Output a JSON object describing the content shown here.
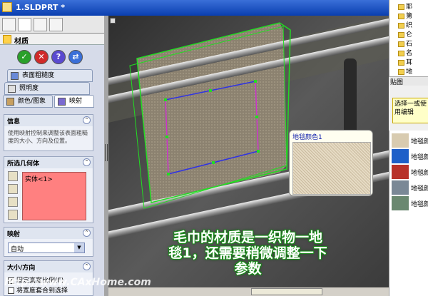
{
  "window": {
    "title": "1.SLDPRT *"
  },
  "panel": {
    "header": "材质",
    "tabs": [
      {
        "label": "表面粗糙度"
      },
      {
        "label": "照明度"
      },
      {
        "label": "颜色/图象"
      },
      {
        "label": "映射"
      }
    ],
    "info": {
      "title": "信息",
      "text": "使用映射控制来调整该表面粗糙度的大小、方向及位置。"
    },
    "selected_geometry": {
      "title": "所选几何体",
      "item": "实体<1>"
    },
    "mapping": {
      "title": "映射",
      "value": "自动"
    },
    "size_direction": {
      "title": "大小/方向",
      "fixed_ratio_label": "固定高宽比例(F)",
      "fixed_ratio_checked": true,
      "second_label": "将宽度套合到选择"
    }
  },
  "viewport": {
    "callout_title": "地毯颜色1",
    "caption_line1": "毛巾的材质是一织物一地",
    "caption_line2": "毯1，还需要稍微调整一下",
    "caption_line3": "参数"
  },
  "watermark": "http://www.CAxHome.com",
  "right_panel": {
    "tree_items": [
      "耶",
      "第",
      "织",
      "仑",
      "石",
      "名",
      "耳",
      "地"
    ],
    "decal_row": "贴图",
    "tip_text": "选择一或使用编辑",
    "swatches": [
      {
        "label": "地毯颜",
        "color": "#d8cbb0"
      },
      {
        "label": "地毯颜",
        "color": "#1e5fc8"
      },
      {
        "label": "地毯颜",
        "color": "#b8322a"
      },
      {
        "label": "地毯颜",
        "color": "#7a8896"
      },
      {
        "label": "地毯颜",
        "color": "#6a8870"
      }
    ]
  },
  "colors": {
    "accept": "#2aa02a",
    "cancel": "#d02a2a",
    "help": "#4a4ad0",
    "pin": "#3a6fd8",
    "selection_green": "#22dd22"
  }
}
